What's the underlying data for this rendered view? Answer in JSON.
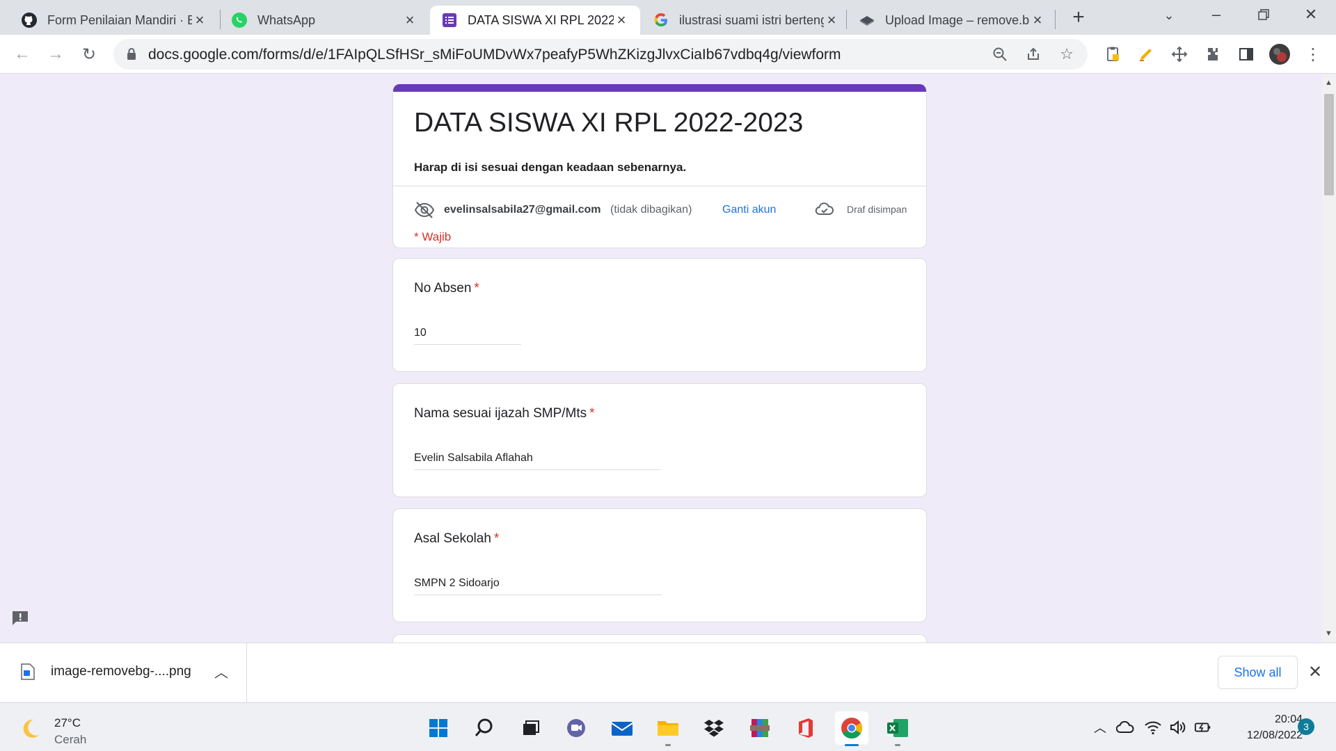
{
  "browser": {
    "tabs": [
      {
        "title": "Form Penilaian Mandiri · E",
        "icon": "github-icon",
        "active": false
      },
      {
        "title": "WhatsApp",
        "icon": "whatsapp-icon",
        "active": false
      },
      {
        "title": "DATA SISWA XI RPL 2022-2023",
        "icon": "google-forms-icon",
        "active": true
      },
      {
        "title": "ilustrasi suami istri bertengkar",
        "icon": "google-icon",
        "active": false
      },
      {
        "title": "Upload Image – remove.bg",
        "icon": "removebg-icon",
        "active": false
      }
    ],
    "url": "docs.google.com/forms/d/e/1FAIpQLSfHSr_sMiFoUMDvWx7peafyP5WhZKizgJlvxCiaIb67vdbq4g/viewform"
  },
  "form": {
    "title": "DATA SISWA XI RPL 2022-2023",
    "description": "Harap di isi sesuai dengan keadaan sebenarnya.",
    "account": {
      "email": "evelinsalsabila27@gmail.com",
      "not_shared": "(tidak dibagikan)",
      "switch_label": "Ganti akun",
      "draft_status": "Draf disimpan"
    },
    "required_note": "* Wajib",
    "questions": [
      {
        "label": "No Absen",
        "required_mark": "*",
        "value": "10"
      },
      {
        "label": "Nama sesuai ijazah SMP/Mts",
        "required_mark": "*",
        "value": "Evelin Salsabila Aflahah"
      },
      {
        "label": "Asal Sekolah",
        "required_mark": "*",
        "value": "SMPN 2 Sidoarjo"
      }
    ]
  },
  "downloads": {
    "file_name": "image-removebg-....png",
    "show_all_label": "Show all"
  },
  "taskbar": {
    "weather_temp": "27°C",
    "weather_condition": "Cerah",
    "time": "20:04",
    "date": "12/08/2022",
    "notification_count": "3"
  },
  "colors": {
    "form_accent": "#673ab7",
    "form_background": "#f0ebf8",
    "required": "#d93025",
    "link": "#1a73e8"
  }
}
